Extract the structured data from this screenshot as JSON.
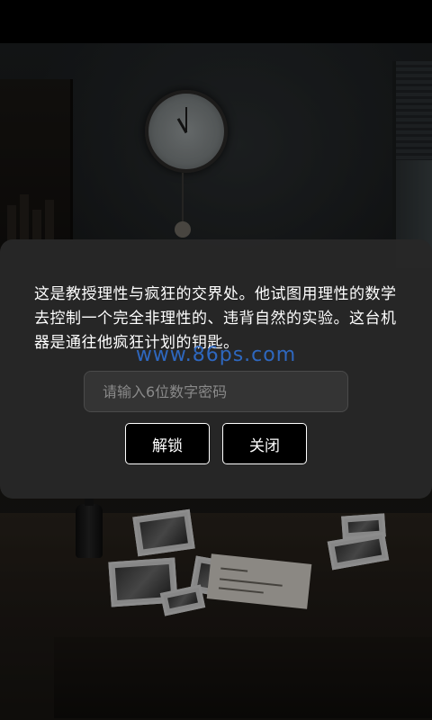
{
  "dialog": {
    "description": "这是教授理性与疯狂的交界处。他试图用理性的数学去控制一个完全非理性的、违背自然的实验。这台机器是通往他疯狂计划的钥匙。",
    "watermark": "www.86ps.com",
    "code_input": {
      "value": "",
      "placeholder": "请输入6位数字密码"
    },
    "unlock_label": "解锁",
    "close_label": "关闭"
  },
  "colors": {
    "dialog_bg": "#282828",
    "button_bg": "#000000",
    "button_border": "#ffffff",
    "text": "#ffffff",
    "watermark": "#2f6fd0"
  },
  "icons": []
}
